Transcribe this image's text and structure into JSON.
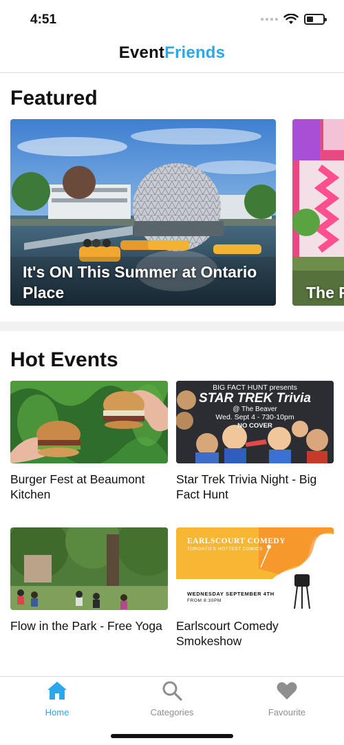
{
  "status_bar": {
    "time": "4:51"
  },
  "header": {
    "title_part1": "Event",
    "title_part2": "Friends"
  },
  "featured": {
    "heading": "Featured",
    "cards": [
      {
        "title": "It's ON This Summer at Ontario Place"
      },
      {
        "title": "The F"
      }
    ]
  },
  "hot_events": {
    "heading": "Hot Events",
    "items": [
      {
        "title": "Burger Fest at Beaumont Kitchen"
      },
      {
        "title": "Star Trek Trivia Night - Big Fact Hunt"
      },
      {
        "title": "Flow in the Park - Free Yoga"
      },
      {
        "title": "Earlscourt Comedy Smokeshow"
      }
    ]
  },
  "poster_star_trek": {
    "line1": "BIG FACT HUNT presents",
    "line2": "STAR TREK Trivia",
    "line3": "@ The Beaver",
    "line4": "Wed. Sept 4 - 730-10pm",
    "line5": "NO COVER"
  },
  "poster_comedy": {
    "line1": "EARLSCOURT COMEDY",
    "line2": "TORONTO'S HOTTEST COMICS",
    "line3": "WEDNESDAY SEPTEMBER 4TH",
    "line4": "FROM 8:30PM"
  },
  "tab_bar": {
    "tabs": [
      {
        "label": "Home",
        "icon": "home-icon"
      },
      {
        "label": "Categories",
        "icon": "search-icon"
      },
      {
        "label": "Favourite",
        "icon": "heart-icon"
      }
    ]
  },
  "colors": {
    "accent": "#2aa8e8",
    "inactive": "#8e8e8e"
  }
}
